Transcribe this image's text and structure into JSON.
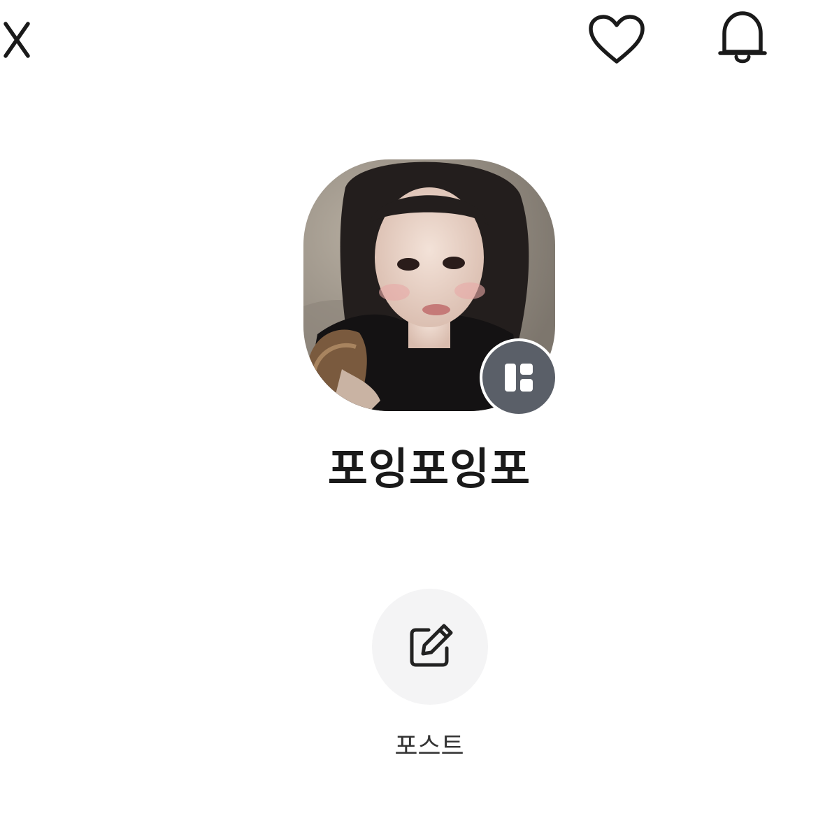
{
  "header": {
    "close_icon": "close-icon",
    "like_icon": "heart-icon",
    "notification_icon": "bell-icon"
  },
  "profile": {
    "name": "포잉포잉포",
    "avatar_description": "profile-photo",
    "badge_icon": "channel-badge-icon"
  },
  "actions": {
    "post": {
      "icon": "edit-icon",
      "label": "포스트"
    }
  },
  "colors": {
    "background": "#ffffff",
    "text": "#1a1a1a",
    "badge": "#5a5f68",
    "button_bg": "#f4f4f5"
  }
}
